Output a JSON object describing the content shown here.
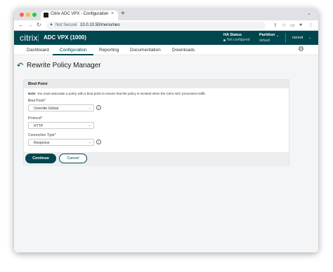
{
  "browser": {
    "tab_title": "Citrix ADC VPX - Configuration",
    "tab_close": "×",
    "new_tab": "+",
    "tab_menu": "⌄",
    "url_security": "Not Secure",
    "url_separator": "|",
    "url": "10.0.10.50/menu/neo",
    "nav_back": "←",
    "nav_forward": "→",
    "nav_reload": "↻",
    "warning_icon": "▲",
    "share_icon": "⇪",
    "star_icon": "☆",
    "sidebar_icon": "▭",
    "profile_icon": "●",
    "menu_icon": "⋮",
    "window_controls": {
      "close_color": "#ff5f57",
      "minimize_color": "#febc2e",
      "zoom_color": "#28c840"
    }
  },
  "header": {
    "logo": "citrix",
    "product": "ADC VPX (1000)",
    "ha_title": "HA Status",
    "ha_status": "Not configured",
    "partition_title": "Partition",
    "partition_value": "default",
    "user": "nsroot",
    "chevron": "⌄",
    "brand_color": "#00464f"
  },
  "nav": {
    "items": [
      "Dashboard",
      "Configuration",
      "Reporting",
      "Documentation",
      "Downloads"
    ],
    "active": "Configuration",
    "settings_icon": "⚙"
  },
  "page": {
    "back_icon": "↶",
    "title": "Rewrite Policy Manager"
  },
  "panel": {
    "title": "Bind Point",
    "note_label": "Note",
    "note_text": ": You must associate a policy with a bind point to ensure that the policy is invoked when the Citrix ADC processes traffic",
    "info_icon": "i",
    "fields": [
      {
        "label": "Bind Point*",
        "value": "Override Global",
        "has_info": true
      },
      {
        "label": "Protocol*",
        "value": "HTTP",
        "has_info": false
      },
      {
        "label": "Connection Type*",
        "value": "Response",
        "has_info": true
      }
    ],
    "continue_label": "Continue",
    "cancel_label": "Cancel"
  }
}
